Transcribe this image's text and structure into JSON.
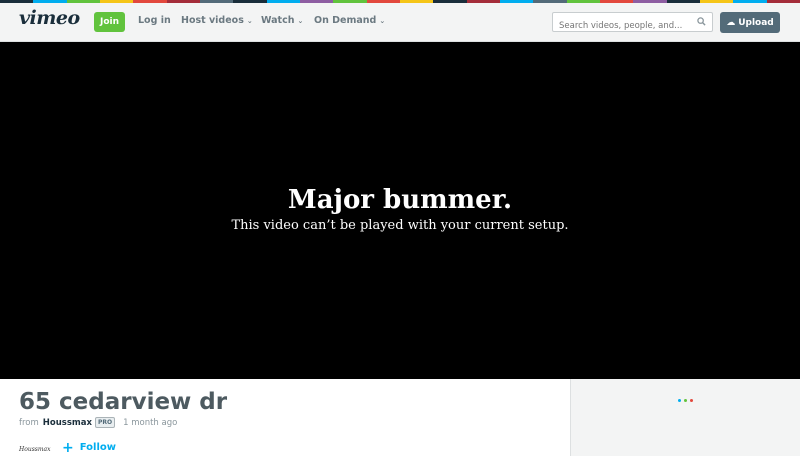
{
  "stripe_colors": [
    "#1a2e3b",
    "#00adef",
    "#61c33d",
    "#f5c518",
    "#e2483d",
    "#a42d3a",
    "#536b79",
    "#1a2e3b",
    "#00adef",
    "#8e5ea2",
    "#61c33d",
    "#e2483d",
    "#f5c518",
    "#1a2e3b",
    "#a42d3a",
    "#00adef",
    "#536b79",
    "#61c33d",
    "#e2483d",
    "#8e5ea2",
    "#1a2e3b",
    "#f5c518",
    "#00adef",
    "#a42d3a"
  ],
  "nav": {
    "logo": "vimeo",
    "join_label": "Join",
    "login_label": "Log in",
    "host_videos_label": "Host videos",
    "watch_label": "Watch",
    "on_demand_label": "On Demand",
    "search_placeholder": "Search videos, people, and...",
    "upload_label": "Upload"
  },
  "player": {
    "error_title": "Major bummer.",
    "error_message": "This video can’t be played with your current setup."
  },
  "video": {
    "title": "65 cedarview dr",
    "from_label": "from",
    "author": "Houssmax",
    "pro_badge": "PRO",
    "posted": "1 month ago",
    "follow_label": "Follow",
    "signature": "Houssmax"
  },
  "loader_colors": [
    "#00adef",
    "#61c33d",
    "#e2483d"
  ]
}
